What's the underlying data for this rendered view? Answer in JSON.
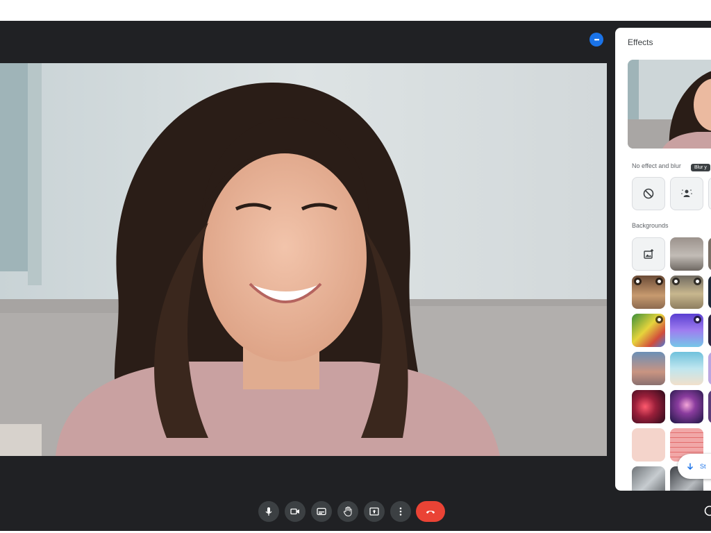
{
  "colors": {
    "stage": "#202124",
    "accent": "#1a73e8",
    "end_call": "#ea4335",
    "control_bg": "#3c4043"
  },
  "topbar": {
    "more_badge": "•••"
  },
  "controls": [
    {
      "name": "microphone",
      "icon": "mic-icon"
    },
    {
      "name": "camera",
      "icon": "camera-icon"
    },
    {
      "name": "captions",
      "icon": "captions-icon"
    },
    {
      "name": "raise-hand",
      "icon": "hand-icon"
    },
    {
      "name": "present",
      "icon": "present-icon"
    },
    {
      "name": "more-options",
      "icon": "more-vert-icon"
    },
    {
      "name": "end-call",
      "icon": "phone-hangup-icon"
    }
  ],
  "effects_panel": {
    "title": "Effects",
    "no_effect_section": "No effect and blur",
    "tooltip": "Blur y",
    "backgrounds_section": "Backgrounds",
    "fab_label": "St"
  }
}
